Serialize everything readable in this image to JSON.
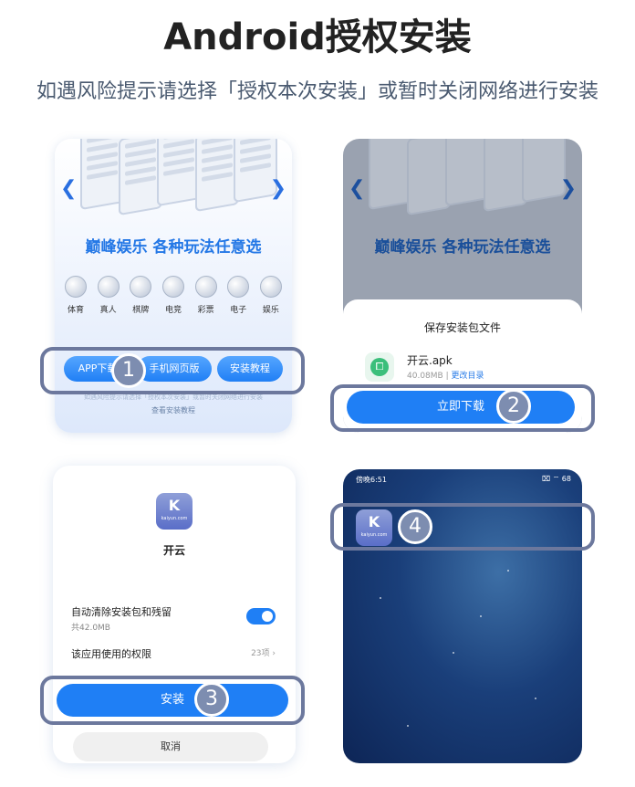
{
  "header": {
    "title": "Android授权安装",
    "subtitle": "如遇风险提示请选择「授权本次安装」或暂时关闭网络进行安装"
  },
  "step1": {
    "slogan": "巅峰娱乐 各种玩法任意选",
    "games": [
      "体育",
      "真人",
      "棋牌",
      "电竞",
      "彩票",
      "电子",
      "娱乐"
    ],
    "buttons": [
      "APP下载",
      "手机网页版",
      "安装教程"
    ],
    "faint_text": "如遇风险提示请选择「授权本次安装」或暂时关闭网络进行安装",
    "tutorial_link": "查看安装教程",
    "prev_icon": "chevron-left-icon",
    "next_icon": "chevron-right-icon"
  },
  "step2": {
    "slogan": "巅峰娱乐 各种玩法任意选",
    "sheet_title": "保存安装包文件",
    "apk_name": "开云.apk",
    "apk_size": "40.08MB",
    "change_dir": "更改目录",
    "download_button": "立即下载"
  },
  "step3": {
    "app_icon_text": "K",
    "app_icon_domain": "kaiyun.com",
    "app_name": "开云",
    "auto_clean_label": "自动清除安装包和残留",
    "auto_clean_size": "共42.0MB",
    "auto_clean_enabled": true,
    "permissions_label": "该应用使用的权限",
    "permissions_count": "23项",
    "install_button": "安装",
    "cancel_button": "取消"
  },
  "step4": {
    "status_time": "傍晚6:51",
    "status_right": "⌧ ⌔ 68",
    "app_icon_text": "K",
    "app_icon_domain": "kaiyun.com"
  },
  "badges": [
    "1",
    "2",
    "3",
    "4"
  ],
  "colors": {
    "accent": "#1f7ff5",
    "badge": "#7d8db0",
    "highlight_border": "#6c789d"
  }
}
